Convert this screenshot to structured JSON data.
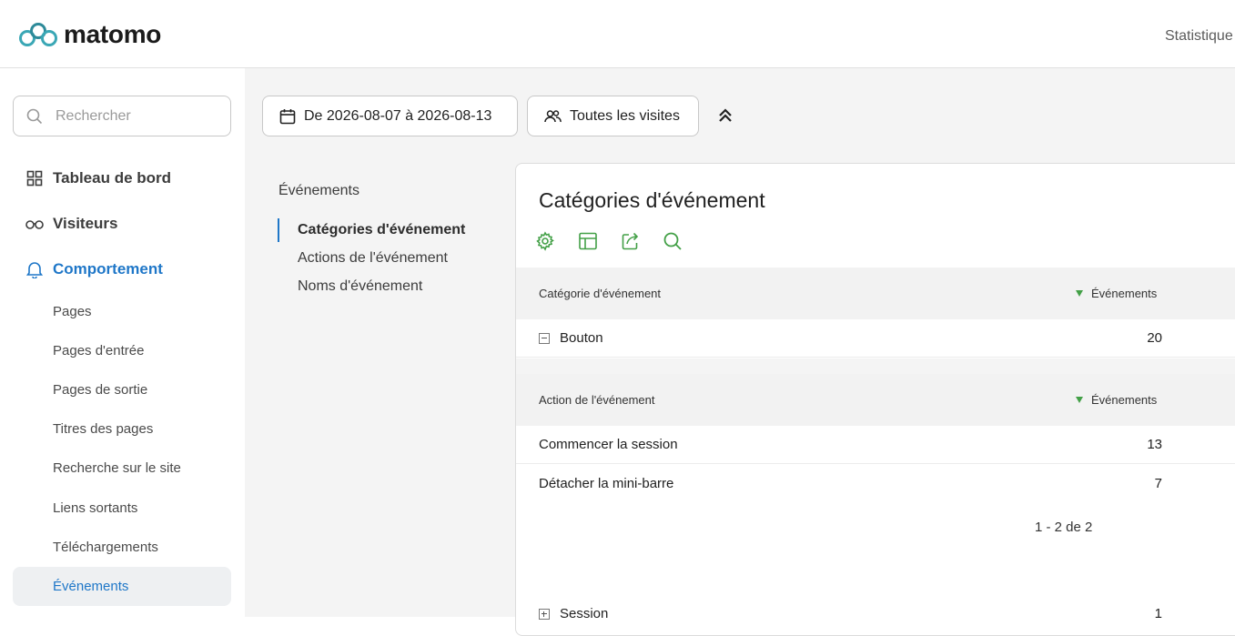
{
  "header": {
    "brand": "matomo",
    "top_link": "Statistique"
  },
  "sidebar": {
    "search_placeholder": "Rechercher",
    "nav": [
      {
        "label": "Tableau de bord",
        "icon": "dashboard-grid-icon"
      },
      {
        "label": "Visiteurs",
        "icon": "binoculars-icon"
      },
      {
        "label": "Comportement",
        "icon": "bell-icon",
        "active": true
      }
    ],
    "sub_items": [
      "Pages",
      "Pages d'entrée",
      "Pages de sortie",
      "Titres des pages",
      "Recherche sur le site",
      "Liens sortants",
      "Téléchargements",
      "Événements"
    ],
    "active_sub": "Événements"
  },
  "toolbar": {
    "date_range": "De 2026-08-07 à 2026-08-13",
    "segment": "Toutes les visites"
  },
  "subnav": {
    "title": "Événements",
    "items": [
      "Catégories d'événement",
      "Actions de l'événement",
      "Noms d'événement"
    ]
  },
  "report": {
    "title": "Catégories d'événement",
    "tools": [
      "settings-icon",
      "table-view-icon",
      "export-icon",
      "search-icon"
    ],
    "main_table": {
      "col_label": "Catégorie d'événement",
      "col_value": "Événements",
      "rows": [
        {
          "label": "Bouton",
          "value": "20",
          "expanded": true
        },
        {
          "label": "Session",
          "value": "1",
          "expanded": false
        }
      ]
    },
    "sub_table": {
      "col_label": "Action de l'événement",
      "col_value": "Événements",
      "rows": [
        {
          "label": "Commencer la session",
          "value": "13"
        },
        {
          "label": "Détacher la mini-barre",
          "value": "7"
        }
      ],
      "pagination": "1 - 2 de 2"
    }
  },
  "colors": {
    "accent_blue": "#1f77c8",
    "logo_teal": "#3aa7b5",
    "tool_green": "#43a047",
    "main_bg": "#f4f4f4"
  }
}
